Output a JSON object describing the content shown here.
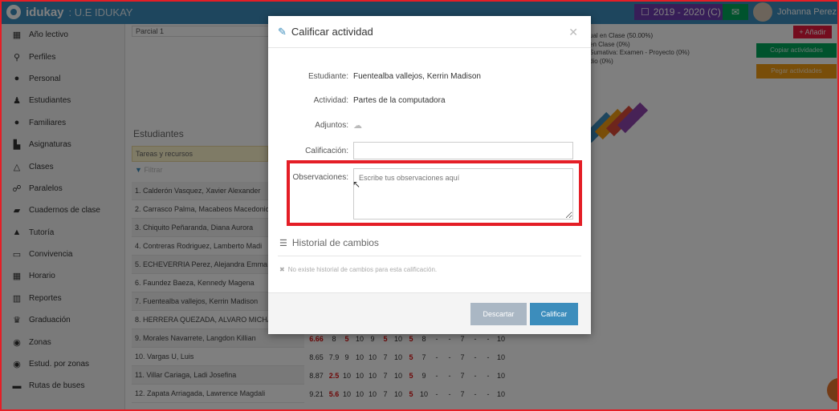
{
  "header": {
    "brand": "idukay",
    "school": ": U.E IDUKAY",
    "year": "2019 - 2020 (C)",
    "user": "Johanna Perez"
  },
  "sidebar": {
    "items": [
      {
        "label": "Año lectivo",
        "icon": "calendar-icon",
        "glyph": "▦"
      },
      {
        "label": "Perfiles",
        "icon": "profiles-icon",
        "glyph": "⚲"
      },
      {
        "label": "Personal",
        "icon": "user-icon",
        "glyph": "●"
      },
      {
        "label": "Estudiantes",
        "icon": "student-icon",
        "glyph": "♟"
      },
      {
        "label": "Familiares",
        "icon": "family-icon",
        "glyph": "●"
      },
      {
        "label": "Asignaturas",
        "icon": "subjects-icon",
        "glyph": "▙"
      },
      {
        "label": "Clases",
        "icon": "classes-icon",
        "glyph": "△"
      },
      {
        "label": "Paralelos",
        "icon": "sitemap-icon",
        "glyph": "☍"
      },
      {
        "label": "Cuadernos de clase",
        "icon": "notebook-icon",
        "glyph": "▰"
      },
      {
        "label": "Tutoría",
        "icon": "thumbs-up-icon",
        "glyph": "▲"
      },
      {
        "label": "Convivencia",
        "icon": "monitor-icon",
        "glyph": "▭"
      },
      {
        "label": "Horario",
        "icon": "schedule-icon",
        "glyph": "▦"
      },
      {
        "label": "Reportes",
        "icon": "chart-icon",
        "glyph": "▥"
      },
      {
        "label": "Graduación",
        "icon": "graduation-icon",
        "glyph": "♛"
      },
      {
        "label": "Zonas",
        "icon": "globe-icon",
        "glyph": "◉"
      },
      {
        "label": "Estud. por zonas",
        "icon": "globe-icon",
        "glyph": "◉"
      },
      {
        "label": "Rutas de buses",
        "icon": "bus-icon",
        "glyph": "▬"
      }
    ]
  },
  "background": {
    "parcial": "Parcial 1",
    "legend": [
      "ual en Clase (50.00%)",
      "en Clase (0%)",
      "Sumativa: Examen - Proyecto (0%)",
      "dio (0%)"
    ],
    "add_label": "+ Añadir",
    "copy_label": "Copiar actividades",
    "paste_label": "Pegar actividades",
    "students_title": "Estudiantes",
    "tareas_label": "Tareas y recursos",
    "filter_label": "Filtrar",
    "students": [
      "1. Calderón Vasquez, Xavier Alexander",
      "2. Carrasco Palma, Macabeos Macedonio",
      "3. Chiquito Peñaranda, Diana Aurora",
      "4. Contreras Rodriguez, Lamberto Madi",
      "5. ECHEVERRIA Perez, Alejandra Emma",
      "6. Faundez Baeza, Kennedy Magena",
      "7. Fuentealba vallejos, Kerrin Madison",
      "8. HERRERA QUEZADA, ALVARO MICHAEL",
      "9. Morales Navarrete, Langdon Killian",
      "10. Vargas U, Luis",
      "11. Villar Cariaga, Ladi Josefina",
      "12. Zapata Arriagada, Lawrence Magdali"
    ],
    "grades": [
      [
        "6.66",
        "8",
        "5",
        "10",
        "9",
        "5",
        "10",
        "5",
        "8",
        "-",
        "-",
        "7",
        "-",
        "-",
        "10"
      ],
      [
        "8.65",
        "7.9",
        "9",
        "10",
        "10",
        "7",
        "10",
        "5",
        "7",
        "-",
        "-",
        "7",
        "-",
        "-",
        "10"
      ],
      [
        "8.87",
        "2.5",
        "10",
        "10",
        "10",
        "7",
        "10",
        "5",
        "9",
        "-",
        "-",
        "7",
        "-",
        "-",
        "10"
      ],
      [
        "9.21",
        "5.6",
        "10",
        "10",
        "10",
        "7",
        "10",
        "5",
        "10",
        "-",
        "-",
        "7",
        "-",
        "-",
        "10"
      ]
    ]
  },
  "modal": {
    "title": "Calificar actividad",
    "student_label": "Estudiante:",
    "student_value": "Fuentealba vallejos, Kerrin Madison",
    "activity_label": "Actividad:",
    "activity_value": "Partes de la computadora",
    "attachments_label": "Adjuntos:",
    "grade_label": "Calificación:",
    "grade_value": "",
    "observations_label": "Observaciones:",
    "observations_placeholder": "Escribe tus observaciones aquí",
    "history_title": "Historial de cambios",
    "history_empty": "No existe historial de cambios para esta calificación.",
    "discard_label": "Descartar",
    "grade_button_label": "Calificar"
  },
  "colors": {
    "primary": "#3c8dbc",
    "highlight": "#e41e26",
    "red_grade": "#d11111"
  }
}
